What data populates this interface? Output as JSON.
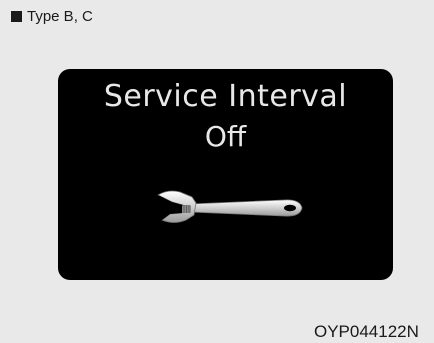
{
  "header": {
    "label": "Type B, C"
  },
  "display": {
    "line1": "Service Interval",
    "line2": "Off",
    "icon": "wrench-icon"
  },
  "figure": {
    "code": "OYP044122N"
  }
}
